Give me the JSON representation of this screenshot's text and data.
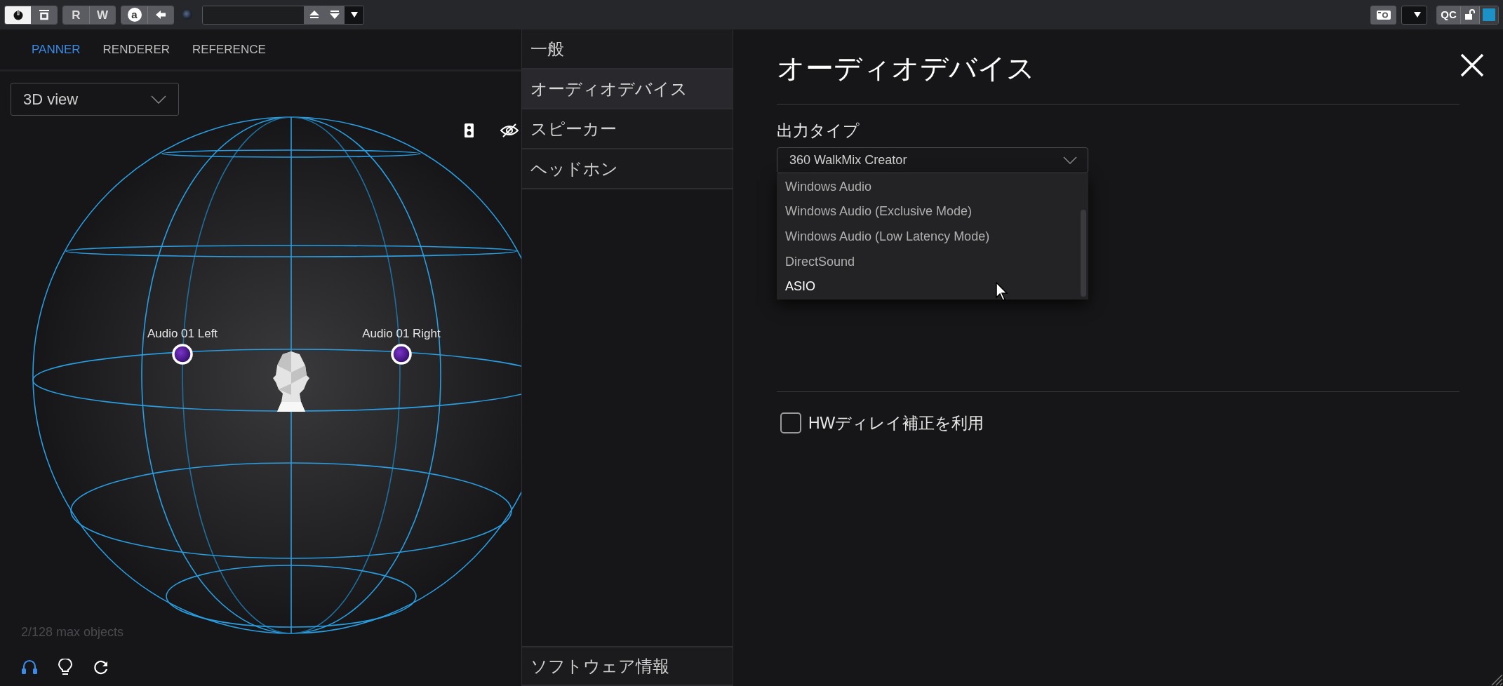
{
  "toolbar": {
    "rw_buttons": [
      {
        "label": "R"
      },
      {
        "label": "W"
      }
    ],
    "auto_label": "a",
    "qc_label": "QC"
  },
  "panner_tabs": [
    {
      "label": "PANNER",
      "selected": true
    },
    {
      "label": "RENDERER",
      "selected": false
    },
    {
      "label": "REFERENCE",
      "selected": false
    }
  ],
  "view_select": {
    "value": "3D view"
  },
  "objects": [
    {
      "name": "Audio 01 Left"
    },
    {
      "name": "Audio 01 Right"
    }
  ],
  "object_count": "2/128 max objects",
  "bottom_tools": [
    {
      "kind": "headphones",
      "active": true
    },
    {
      "kind": "bulb",
      "active": false
    },
    {
      "kind": "reset",
      "active": false
    }
  ],
  "settings_nav": {
    "items": [
      {
        "label": "一般",
        "selected": false
      },
      {
        "label": "オーディオデバイス",
        "selected": true
      },
      {
        "label": "スピーカー",
        "selected": false
      },
      {
        "label": "ヘッドホン",
        "selected": false
      }
    ],
    "footer": {
      "label": "ソフトウェア情報",
      "selected": false
    }
  },
  "audio_device": {
    "title": "オーディオデバイス",
    "output_type": {
      "label": "出力タイプ",
      "value": "360 WalkMix Creator",
      "options": [
        {
          "label": "Windows Audio",
          "hovered": false
        },
        {
          "label": "Windows Audio (Exclusive Mode)",
          "hovered": false
        },
        {
          "label": "Windows Audio (Low Latency Mode)",
          "hovered": false
        },
        {
          "label": "DirectSound",
          "hovered": false
        },
        {
          "label": "ASIO",
          "hovered": true
        }
      ]
    },
    "hw_delay": {
      "label": "HWディレイ補正を利用",
      "checked": false
    }
  }
}
